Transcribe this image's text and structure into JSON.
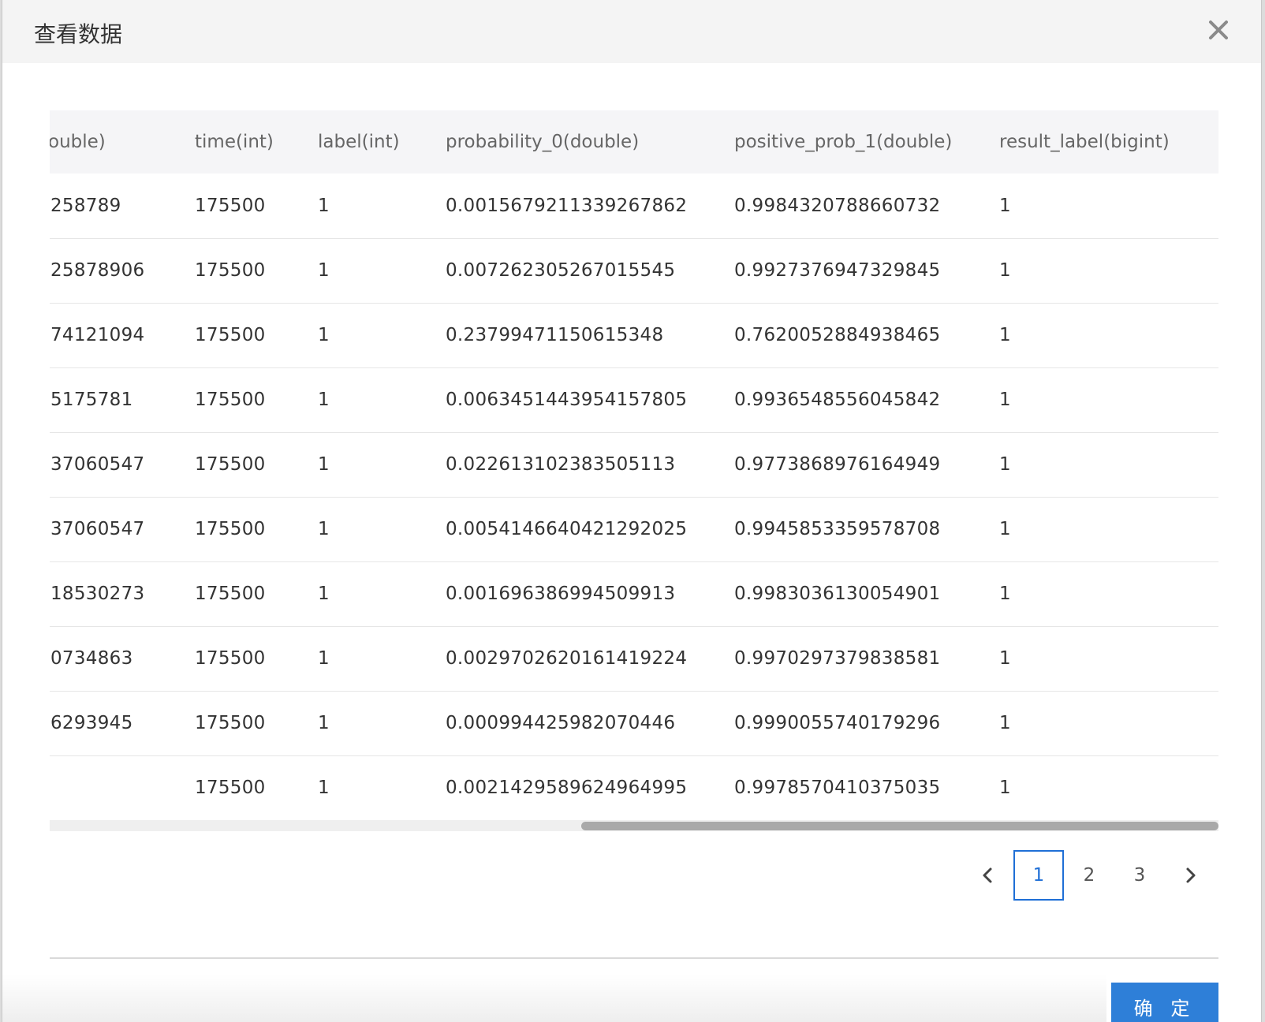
{
  "modal": {
    "title": "查看数据",
    "confirm_label": "确 定"
  },
  "table": {
    "columns": [
      "ouble)",
      "time(int)",
      "label(int)",
      "probability_0(double)",
      "positive_prob_1(double)",
      "result_label(bigint)"
    ],
    "rows": [
      [
        "258789",
        "175500",
        "1",
        "0.0015679211339267862",
        "0.9984320788660732",
        "1"
      ],
      [
        "25878906",
        "175500",
        "1",
        "0.007262305267015545",
        "0.9927376947329845",
        "1"
      ],
      [
        "74121094",
        "175500",
        "1",
        "0.23799471150615348",
        "0.7620052884938465",
        "1"
      ],
      [
        "5175781",
        "175500",
        "1",
        "0.0063451443954157805",
        "0.9936548556045842",
        "1"
      ],
      [
        "37060547",
        "175500",
        "1",
        "0.022613102383505113",
        "0.9773868976164949",
        "1"
      ],
      [
        "37060547",
        "175500",
        "1",
        "0.0054146640421292025",
        "0.9945853359578708",
        "1"
      ],
      [
        "18530273",
        "175500",
        "1",
        "0.001696386994509913",
        "0.9983036130054901",
        "1"
      ],
      [
        "0734863",
        "175500",
        "1",
        "0.0029702620161419224",
        "0.9970297379838581",
        "1"
      ],
      [
        "6293945",
        "175500",
        "1",
        "0.000994425982070446",
        "0.9990055740179296",
        "1"
      ],
      [
        "",
        "175500",
        "1",
        "0.0021429589624964995",
        "0.9978570410375035",
        "1"
      ]
    ]
  },
  "pagination": {
    "pages": [
      "1",
      "2",
      "3"
    ],
    "current": "1"
  },
  "colors": {
    "accent": "#2e7fd8",
    "active_page": "#1f6fd6"
  },
  "icons": {
    "close": "close-icon",
    "prev": "chevron-left-icon",
    "next": "chevron-right-icon"
  }
}
